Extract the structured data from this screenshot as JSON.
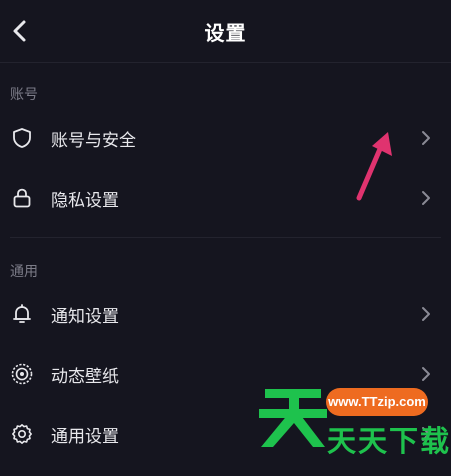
{
  "header": {
    "title": "设置",
    "back_icon": "chevron-left-icon"
  },
  "sections": [
    {
      "label": "账号",
      "items": [
        {
          "label": "账号与安全",
          "icon": "shield-icon"
        },
        {
          "label": "隐私设置",
          "icon": "lock-icon"
        }
      ]
    },
    {
      "label": "通用",
      "items": [
        {
          "label": "通知设置",
          "icon": "bell-icon"
        },
        {
          "label": "动态壁纸",
          "icon": "live-wallpaper-icon"
        },
        {
          "label": "通用设置",
          "icon": "gear-icon"
        }
      ]
    }
  ],
  "watermark": {
    "url": "www.TTzip.com",
    "text": "天天下载",
    "logo_char": "天",
    "pill_color": "#ee6b20",
    "text_color": "#1ec24d"
  },
  "annotation": {
    "arrow_color": "#e0336f"
  },
  "colors": {
    "background": "#15151f",
    "text": "#e8e8ec",
    "muted": "#7c7c88",
    "divider": "#23232e"
  }
}
